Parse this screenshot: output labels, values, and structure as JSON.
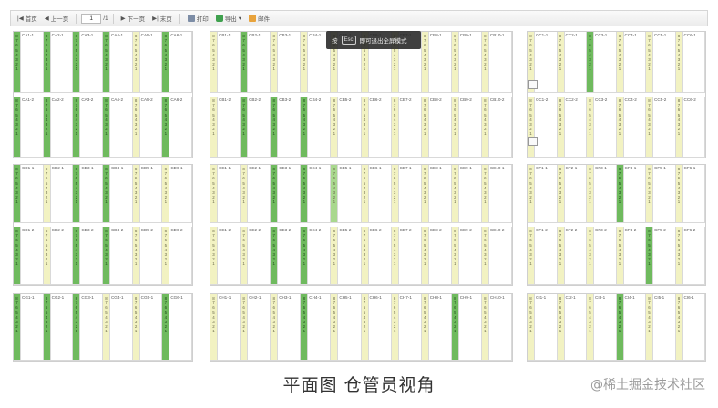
{
  "toolbar": {
    "first_label": "首页",
    "prev_label": "上一页",
    "page_value": "1",
    "page_total": "/1",
    "next_label": "下一页",
    "last_label": "末页",
    "print_label": "打印",
    "export_label": "导出",
    "email_label": "邮件"
  },
  "overlay": {
    "press_label": "按",
    "key_label": "Esc",
    "message": "即可退出全屏模式"
  },
  "caption": "平面图 仓管员视角",
  "watermark": "@稀土掘金技术社区",
  "colors": {
    "empty_slot": "#f2f2c2",
    "occupied_slot": "#6fba5e",
    "partial_slot": "#a9d88e"
  },
  "panels": [
    {
      "rows": [
        [
          {
            "code": "CA1-1",
            "fill": "green"
          },
          {
            "code": "CA2-1",
            "fill": "green"
          },
          {
            "code": "CA3-1",
            "fill": "green"
          },
          {
            "code": "CA4-1",
            "fill": "green"
          },
          {
            "code": "CA5-1",
            "fill": "empty"
          },
          {
            "code": "CA6-1",
            "fill": "green"
          }
        ],
        [
          {
            "code": "CA1-2",
            "fill": "green"
          },
          {
            "code": "CA2-2",
            "fill": "green"
          },
          {
            "code": "CA3-2",
            "fill": "green"
          },
          {
            "code": "CA4-2",
            "fill": "green"
          },
          {
            "code": "CA5-2",
            "fill": "empty"
          },
          {
            "code": "CA6-2",
            "fill": "green"
          }
        ]
      ]
    },
    {
      "rows": [
        [
          {
            "code": "CB1-1",
            "fill": "empty"
          },
          {
            "code": "CB2-1",
            "fill": "green"
          },
          {
            "code": "CB3-1",
            "fill": "empty"
          },
          {
            "code": "CB4-1",
            "fill": "empty"
          },
          {
            "code": "CB5-1",
            "fill": "empty"
          },
          {
            "code": "CB6-1",
            "fill": "empty"
          },
          {
            "code": "CB7-1",
            "fill": "empty"
          },
          {
            "code": "CB8-1",
            "fill": "empty"
          },
          {
            "code": "CB9-1",
            "fill": "empty"
          },
          {
            "code": "CB10-1",
            "fill": "empty"
          }
        ],
        [
          {
            "code": "CB1-2",
            "fill": "empty"
          },
          {
            "code": "CB2-2",
            "fill": "green"
          },
          {
            "code": "CB3-2",
            "fill": "green"
          },
          {
            "code": "CB4-2",
            "fill": "green"
          },
          {
            "code": "CB5-2",
            "fill": "empty"
          },
          {
            "code": "CB6-2",
            "fill": "empty"
          },
          {
            "code": "CB7-2",
            "fill": "empty"
          },
          {
            "code": "CB8-2",
            "fill": "empty"
          },
          {
            "code": "CB9-2",
            "fill": "empty"
          },
          {
            "code": "CB10-2",
            "fill": "empty"
          }
        ]
      ]
    },
    {
      "rows": [
        [
          {
            "code": "CC1-1",
            "fill": "empty"
          },
          {
            "code": "CC2-1",
            "fill": "empty"
          },
          {
            "code": "CC3-1",
            "fill": "green"
          },
          {
            "code": "CC4-1",
            "fill": "empty"
          },
          {
            "code": "CC5-1",
            "fill": "empty"
          },
          {
            "code": "CC6-1",
            "fill": "empty"
          }
        ],
        [
          {
            "code": "CC1-2",
            "fill": "empty"
          },
          {
            "code": "CC2-2",
            "fill": "empty"
          },
          {
            "code": "CC3-2",
            "fill": "empty"
          },
          {
            "code": "CC4-2",
            "fill": "empty"
          },
          {
            "code": "CC5-2",
            "fill": "empty"
          },
          {
            "code": "CC6-2",
            "fill": "empty"
          }
        ]
      ]
    },
    {
      "rows": [
        [
          {
            "code": "CD1-1",
            "fill": "green"
          },
          {
            "code": "CD2-1",
            "fill": "empty"
          },
          {
            "code": "CD3-1",
            "fill": "green"
          },
          {
            "code": "CD4-1",
            "fill": "green"
          },
          {
            "code": "CD5-1",
            "fill": "empty"
          },
          {
            "code": "CD6-1",
            "fill": "empty"
          }
        ],
        [
          {
            "code": "CD1-2",
            "fill": "green"
          },
          {
            "code": "CD2-2",
            "fill": "empty"
          },
          {
            "code": "CD3-2",
            "fill": "green"
          },
          {
            "code": "CD4-2",
            "fill": "green"
          },
          {
            "code": "CD5-2",
            "fill": "empty"
          },
          {
            "code": "CD6-2",
            "fill": "empty"
          }
        ]
      ]
    },
    {
      "rows": [
        [
          {
            "code": "CE1-1",
            "fill": "empty"
          },
          {
            "code": "CE2-1",
            "fill": "empty"
          },
          {
            "code": "CE3-1",
            "fill": "green"
          },
          {
            "code": "CE4-1",
            "fill": "green"
          },
          {
            "code": "CE5-1",
            "fill": "lgreen"
          },
          {
            "code": "CE6-1",
            "fill": "empty"
          },
          {
            "code": "CE7-1",
            "fill": "empty"
          },
          {
            "code": "CE8-1",
            "fill": "empty"
          },
          {
            "code": "CE9-1",
            "fill": "empty"
          },
          {
            "code": "CE10-1",
            "fill": "empty"
          }
        ],
        [
          {
            "code": "CE1-2",
            "fill": "empty"
          },
          {
            "code": "CE2-2",
            "fill": "empty"
          },
          {
            "code": "CE3-2",
            "fill": "green"
          },
          {
            "code": "CE4-2",
            "fill": "green"
          },
          {
            "code": "CE5-2",
            "fill": "empty"
          },
          {
            "code": "CE6-2",
            "fill": "empty"
          },
          {
            "code": "CE7-2",
            "fill": "empty"
          },
          {
            "code": "CE8-2",
            "fill": "empty"
          },
          {
            "code": "CE9-2",
            "fill": "empty"
          },
          {
            "code": "CE10-2",
            "fill": "empty"
          }
        ]
      ]
    },
    {
      "rows": [
        [
          {
            "code": "CF1-1",
            "fill": "empty"
          },
          {
            "code": "CF2-1",
            "fill": "empty"
          },
          {
            "code": "CF3-1",
            "fill": "empty"
          },
          {
            "code": "CF4-1",
            "fill": "green"
          },
          {
            "code": "CF5-1",
            "fill": "empty"
          },
          {
            "code": "CF6-1",
            "fill": "empty"
          }
        ],
        [
          {
            "code": "CF1-2",
            "fill": "empty"
          },
          {
            "code": "CF2-2",
            "fill": "empty"
          },
          {
            "code": "CF3-2",
            "fill": "empty"
          },
          {
            "code": "CF4-2",
            "fill": "empty"
          },
          {
            "code": "CF5-2",
            "fill": "green"
          },
          {
            "code": "CF6-2",
            "fill": "empty"
          }
        ]
      ]
    },
    {
      "rows": [
        [
          {
            "code": "CG1-1",
            "fill": "green"
          },
          {
            "code": "CG2-1",
            "fill": "green"
          },
          {
            "code": "CG3-1",
            "fill": "green"
          },
          {
            "code": "CG4-1",
            "fill": "empty"
          },
          {
            "code": "CG5-1",
            "fill": "empty"
          },
          {
            "code": "CG6-1",
            "fill": "green"
          }
        ]
      ]
    },
    {
      "rows": [
        [
          {
            "code": "CH1-1",
            "fill": "empty"
          },
          {
            "code": "CH2-1",
            "fill": "empty"
          },
          {
            "code": "CH3-1",
            "fill": "empty"
          },
          {
            "code": "CH4-1",
            "fill": "green"
          },
          {
            "code": "CH5-1",
            "fill": "empty"
          },
          {
            "code": "CH6-1",
            "fill": "empty"
          },
          {
            "code": "CH7-1",
            "fill": "empty"
          },
          {
            "code": "CH8-1",
            "fill": "empty"
          },
          {
            "code": "CH9-1",
            "fill": "green"
          },
          {
            "code": "CH10-1",
            "fill": "empty"
          }
        ]
      ]
    },
    {
      "rows": [
        [
          {
            "code": "CI1-1",
            "fill": "empty"
          },
          {
            "code": "CI2-1",
            "fill": "empty"
          },
          {
            "code": "CI3-1",
            "fill": "empty"
          },
          {
            "code": "CI4-1",
            "fill": "green"
          },
          {
            "code": "CI5-1",
            "fill": "empty"
          },
          {
            "code": "CI6-1",
            "fill": "empty"
          }
        ]
      ]
    }
  ]
}
